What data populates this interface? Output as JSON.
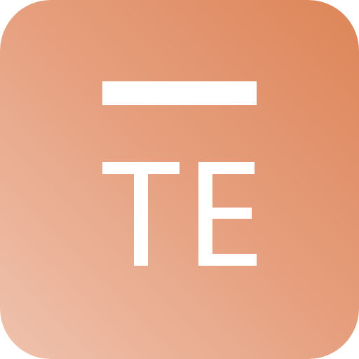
{
  "icon": {
    "name": "te-app-icon",
    "letters": "TE",
    "colors": {
      "gradient_start": "#EFC2AE",
      "gradient_mid": "#E6A07F",
      "gradient_end": "#DD8558",
      "glyph": "#FFFFFF"
    }
  }
}
